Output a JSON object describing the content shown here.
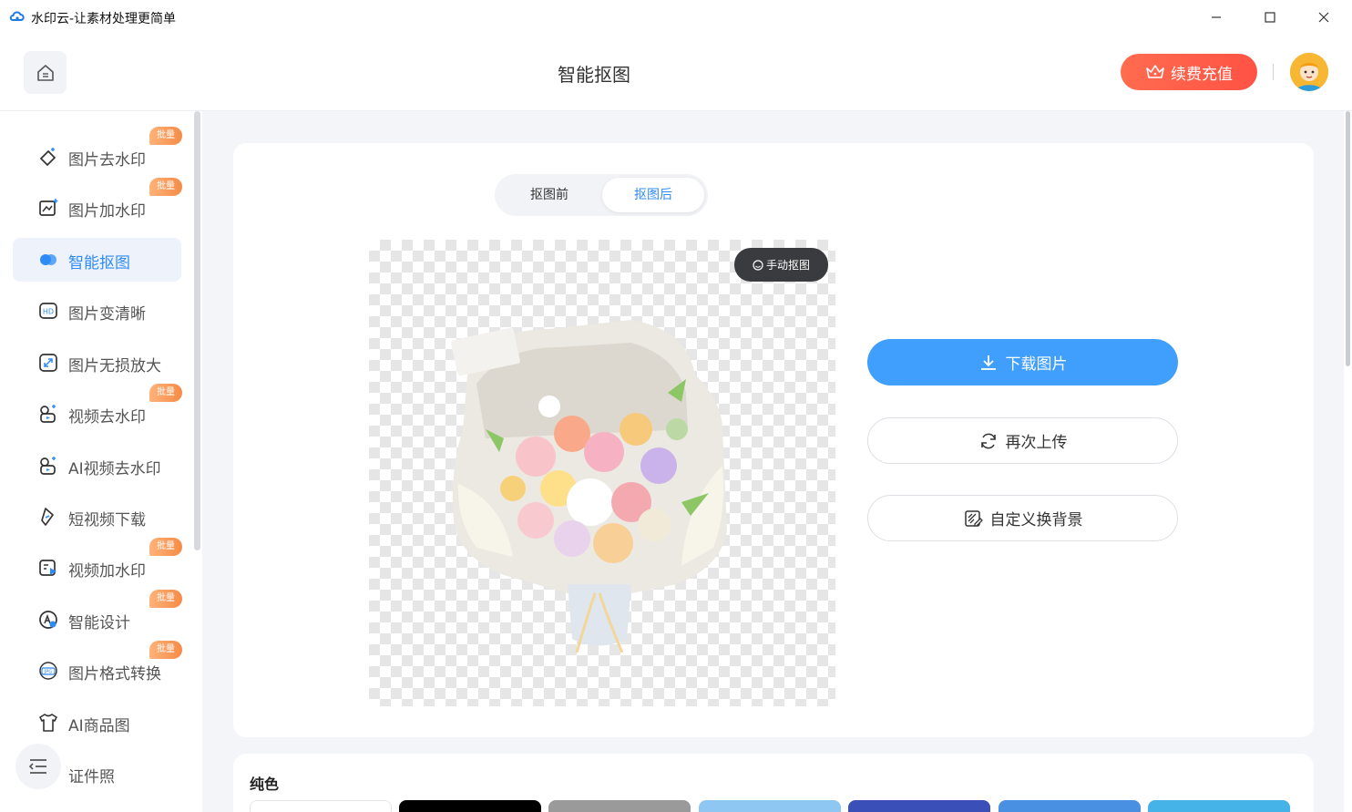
{
  "window": {
    "title": "水印云-让素材处理更简单"
  },
  "header": {
    "page_title": "智能抠图",
    "vip_label": "续费充值"
  },
  "sidebar": {
    "items": [
      {
        "label": "图片去水印",
        "badge": "批量",
        "icon": "eraser-icon"
      },
      {
        "label": "图片加水印",
        "badge": "批量",
        "icon": "image-add-icon"
      },
      {
        "label": "智能抠图",
        "badge": "",
        "icon": "cutout-icon",
        "active": true
      },
      {
        "label": "图片变清晰",
        "badge": "",
        "icon": "hd-icon"
      },
      {
        "label": "图片无损放大",
        "badge": "",
        "icon": "enlarge-icon"
      },
      {
        "label": "视频去水印",
        "badge": "批量",
        "icon": "video-eraser-icon"
      },
      {
        "label": "AI视频去水印",
        "badge": "",
        "icon": "ai-video-icon"
      },
      {
        "label": "短视频下载",
        "badge": "",
        "icon": "link-icon"
      },
      {
        "label": "视频加水印",
        "badge": "批量",
        "icon": "video-add-icon"
      },
      {
        "label": "智能设计",
        "badge": "批量",
        "icon": "design-icon"
      },
      {
        "label": "图片格式转换",
        "badge": "批量",
        "icon": "jpg-icon"
      },
      {
        "label": "AI商品图",
        "badge": "",
        "icon": "shirt-icon"
      },
      {
        "label": "证件照",
        "badge": "",
        "icon": "id-photo-icon"
      }
    ]
  },
  "tabs": {
    "before": "抠图前",
    "after": "抠图后",
    "selected": "after"
  },
  "preview": {
    "manual_label": "手动抠图"
  },
  "actions": {
    "download": "下载图片",
    "reupload": "再次上传",
    "custom_bg": "自定义换背景"
  },
  "backgrounds": {
    "title": "纯色",
    "colors": [
      "#ffffff",
      "#000000",
      "#9a9a9a",
      "#8ec8f2",
      "#3a4fb8",
      "#4a90e2",
      "#45b2e8"
    ]
  }
}
